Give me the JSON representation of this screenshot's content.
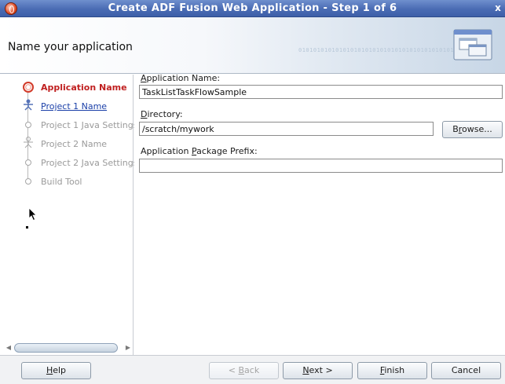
{
  "window": {
    "title": "Create ADF Fusion Web Application - Step 1 of 6",
    "close_glyph": "x",
    "app_icon": "oracle-jdeveloper-icon"
  },
  "header": {
    "heading": "Name your application",
    "decor_text": "010101010101010101010101010101010101010101010",
    "graphic_icon": "wizard-window-icon"
  },
  "steps": [
    {
      "label": "Application Name",
      "state": "current"
    },
    {
      "label": "Project 1 Name",
      "state": "link"
    },
    {
      "label": "Project 1 Java Settings",
      "state": "disabled"
    },
    {
      "label": "Project 2 Name",
      "state": "disabled"
    },
    {
      "label": "Project 2 Java Settings",
      "state": "disabled"
    },
    {
      "label": "Build Tool",
      "state": "disabled"
    }
  ],
  "form": {
    "app_name": {
      "label_mnemonic": "A",
      "label_rest": "pplication Name:",
      "value": "TaskListTaskFlowSample"
    },
    "directory": {
      "label_mnemonic": "D",
      "label_rest": "irectory:",
      "value": "/scratch/mywork"
    },
    "browse_pre": "B",
    "browse_mnemonic": "r",
    "browse_post": "owse...",
    "package_prefix": {
      "label_pre": "Application ",
      "label_mnemonic": "P",
      "label_rest": "ackage Prefix:",
      "value": ""
    }
  },
  "buttons": {
    "help_mnemonic": "H",
    "help_rest": "elp",
    "back_pre": "< ",
    "back_mnemonic": "B",
    "back_rest": "ack",
    "next_mnemonic": "N",
    "next_rest": "ext >",
    "finish_mnemonic": "F",
    "finish_rest": "inish",
    "cancel": "Cancel"
  },
  "colors": {
    "titlebar": "#4a6cb4",
    "current_step": "#c02020",
    "link": "#1a3fa8",
    "disabled_text": "#9a9a9a"
  }
}
